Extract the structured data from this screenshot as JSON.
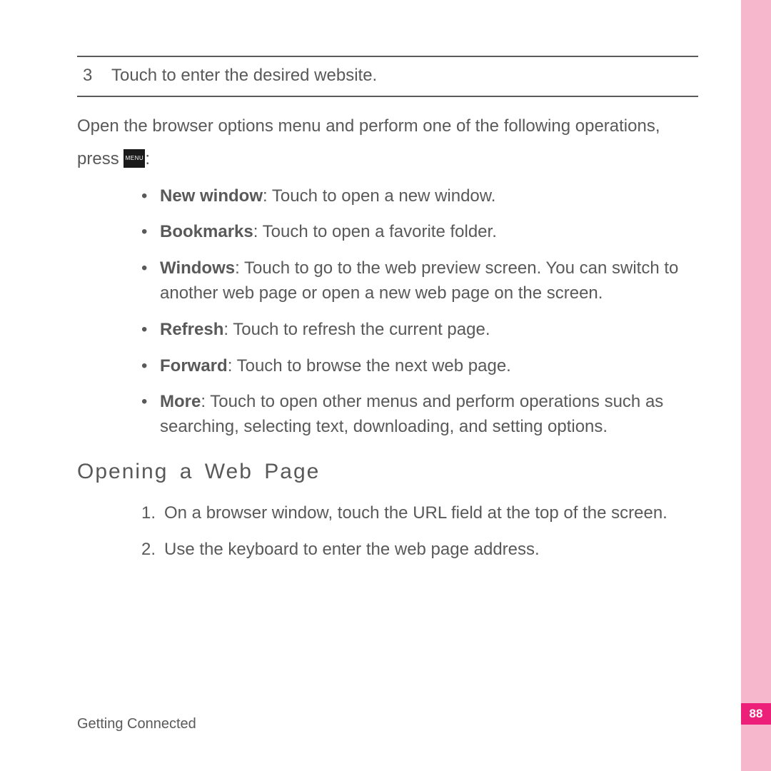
{
  "step_row": {
    "num": "3",
    "text": "Touch to enter the desired website."
  },
  "intro_before": "Open the browser options menu and perform one of the following operations, press ",
  "intro_after": ":",
  "menu_key_label": "MENU",
  "options": [
    {
      "label": "New window",
      "text": ": Touch to open a new window."
    },
    {
      "label": "Bookmarks",
      "text": ": Touch to open a favorite folder."
    },
    {
      "label": "Windows",
      "text": ": Touch to go to the web preview screen. You can switch to another web page or open a new web page on the screen."
    },
    {
      "label": "Refresh",
      "text": ": Touch to refresh the current page."
    },
    {
      "label": "Forward",
      "text": ": Touch to browse the next web page."
    },
    {
      "label": "More",
      "text": ": Touch to open other menus and perform operations such as searching, selecting text, downloading, and setting options."
    }
  ],
  "heading": "Opening a Web Page",
  "steps": [
    "On a browser window, touch the URL field at the top of the screen.",
    "Use the keyboard to enter the web page address."
  ],
  "footer": "Getting Connected",
  "page_number": "88"
}
